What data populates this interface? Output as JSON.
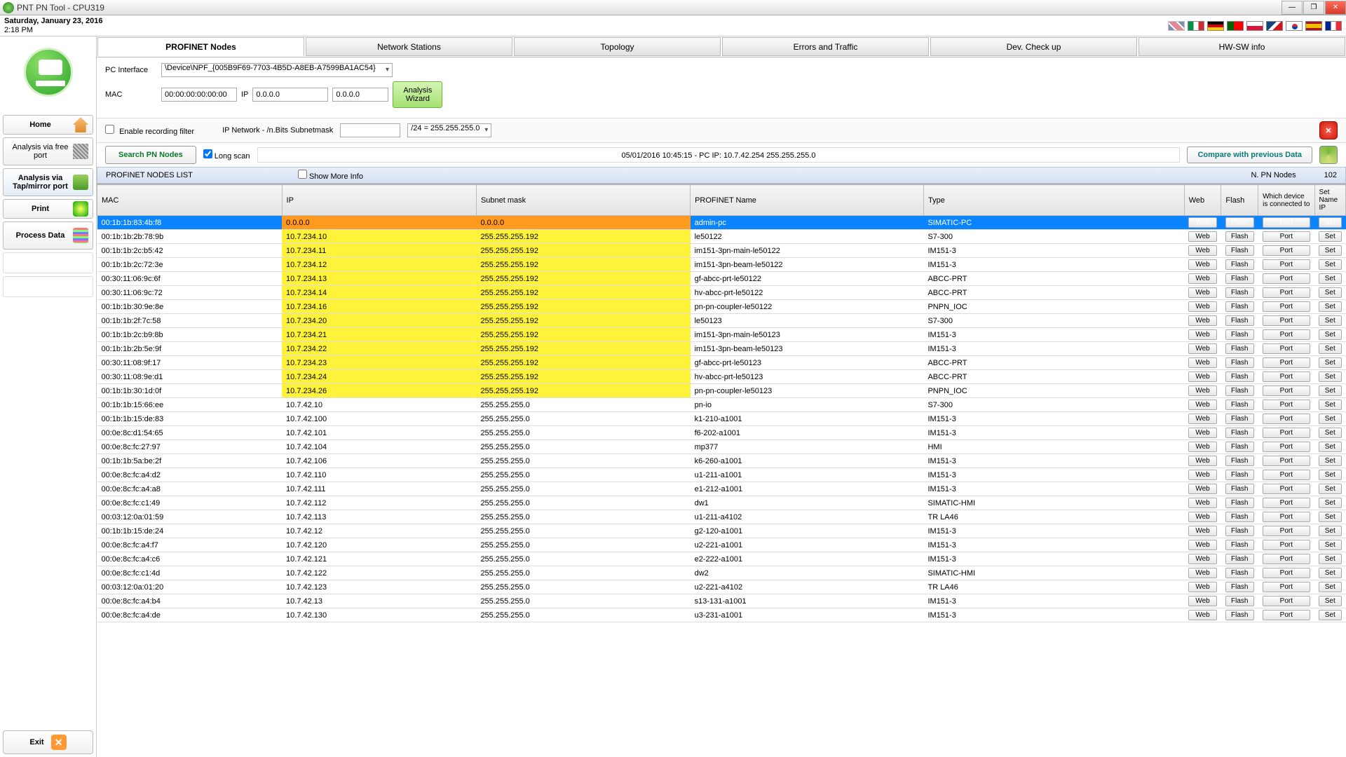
{
  "window": {
    "title": "PNT PN Tool - CPU319",
    "date": "Saturday, January 23, 2016",
    "time": "2:18 PM"
  },
  "sidebar": {
    "home": "Home",
    "analysis_free": "Analysis via free port",
    "analysis_tap": "Analysis via Tap/mirror port",
    "print": "Print",
    "process_data": "Process Data",
    "exit": "Exit"
  },
  "tabs": [
    "PROFINET Nodes",
    "Network Stations",
    "Topology",
    "Errors and Traffic",
    "Dev. Check up",
    "HW-SW info"
  ],
  "toolbar": {
    "pc_interface_label": "PC Interface",
    "pc_interface_value": "\\Device\\NPF_{005B9F69-7703-4B5D-A8EB-A7599BA1AC54}",
    "mac_label": "MAC",
    "mac_value": "00:00:00:00:00:00",
    "ip_label": "IP",
    "ip_value": "0.0.0.0",
    "ip_value2": "0.0.0.0",
    "wizard": "Analysis Wizard",
    "enable_filter": "Enable recording filter",
    "ipnet_label": "IP Network - /n.Bits Subnetmask",
    "mask_select": "/24 = 255.255.255.0",
    "search": "Search PN Nodes",
    "long_scan": "Long scan",
    "scan_info": "05/01/2016   10:45:15 - PC IP: 10.7.42.254  255.255.255.0",
    "compare": "Compare with previous Data",
    "list_title": "PROFINET NODES LIST",
    "show_more": "Show More Info",
    "n_nodes_label": "N. PN Nodes",
    "n_nodes": "102"
  },
  "columns": {
    "mac": "MAC",
    "ip": "IP",
    "mask": "Subnet mask",
    "name": "PROFINET Name",
    "type": "Type",
    "web": "Web",
    "flash": "Flash",
    "port": "Which device is connected to",
    "set": "Set Name IP"
  },
  "btns": {
    "web": "Web",
    "flash": "Flash",
    "port": "Port",
    "set": "Set"
  },
  "rows": [
    {
      "mac": "00:1b:1b:83:4b:f8",
      "ip": "0.0.0.0",
      "mask": "0.0.0.0",
      "name": "admin-pc",
      "type": "SIMATIC-PC",
      "sel": true,
      "y": false
    },
    {
      "mac": "00:1b:1b:2b:78:9b",
      "ip": "10.7.234.10",
      "mask": "255.255.255.192",
      "name": "le50122",
      "type": "S7-300",
      "y": true
    },
    {
      "mac": "00:1b:1b:2c:b5:42",
      "ip": "10.7.234.11",
      "mask": "255.255.255.192",
      "name": "im151-3pn-main-le50122",
      "type": "IM151-3",
      "y": true
    },
    {
      "mac": "00:1b:1b:2c:72:3e",
      "ip": "10.7.234.12",
      "mask": "255.255.255.192",
      "name": "im151-3pn-beam-le50122",
      "type": "IM151-3",
      "y": true
    },
    {
      "mac": "00:30:11:06:9c:6f",
      "ip": "10.7.234.13",
      "mask": "255.255.255.192",
      "name": "gf-abcc-prt-le50122",
      "type": "ABCC-PRT",
      "y": true
    },
    {
      "mac": "00:30:11:06:9c:72",
      "ip": "10.7.234.14",
      "mask": "255.255.255.192",
      "name": "hv-abcc-prt-le50122",
      "type": "ABCC-PRT",
      "y": true
    },
    {
      "mac": "00:1b:1b:30:9e:8e",
      "ip": "10.7.234.16",
      "mask": "255.255.255.192",
      "name": "pn-pn-coupler-le50122",
      "type": "PNPN_IOC",
      "y": true
    },
    {
      "mac": "00:1b:1b:2f:7c:58",
      "ip": "10.7.234.20",
      "mask": "255.255.255.192",
      "name": "le50123",
      "type": "S7-300",
      "y": true
    },
    {
      "mac": "00:1b:1b:2c:b9:8b",
      "ip": "10.7.234.21",
      "mask": "255.255.255.192",
      "name": "im151-3pn-main-le50123",
      "type": "IM151-3",
      "y": true
    },
    {
      "mac": "00:1b:1b:2b:5e:9f",
      "ip": "10.7.234.22",
      "mask": "255.255.255.192",
      "name": "im151-3pn-beam-le50123",
      "type": "IM151-3",
      "y": true
    },
    {
      "mac": "00:30:11:08:9f:17",
      "ip": "10.7.234.23",
      "mask": "255.255.255.192",
      "name": "gf-abcc-prt-le50123",
      "type": "ABCC-PRT",
      "y": true
    },
    {
      "mac": "00:30:11:08:9e:d1",
      "ip": "10.7.234.24",
      "mask": "255.255.255.192",
      "name": "hv-abcc-prt-le50123",
      "type": "ABCC-PRT",
      "y": true
    },
    {
      "mac": "00:1b:1b:30:1d:0f",
      "ip": "10.7.234.26",
      "mask": "255.255.255.192",
      "name": "pn-pn-coupler-le50123",
      "type": "PNPN_IOC",
      "y": true
    },
    {
      "mac": "00:1b:1b:15:66:ee",
      "ip": "10.7.42.10",
      "mask": "255.255.255.0",
      "name": "pn-io",
      "type": "S7-300"
    },
    {
      "mac": "00:1b:1b:15:de:83",
      "ip": "10.7.42.100",
      "mask": "255.255.255.0",
      "name": "k1-210-a1001",
      "type": "IM151-3"
    },
    {
      "mac": "00:0e:8c:d1:54:65",
      "ip": "10.7.42.101",
      "mask": "255.255.255.0",
      "name": "f6-202-a1001",
      "type": "IM151-3"
    },
    {
      "mac": "00:0e:8c:fc:27:97",
      "ip": "10.7.42.104",
      "mask": "255.255.255.0",
      "name": "mp377",
      "type": "HMI"
    },
    {
      "mac": "00:1b:1b:5a:be:2f",
      "ip": "10.7.42.106",
      "mask": "255.255.255.0",
      "name": "k6-260-a1001",
      "type": "IM151-3"
    },
    {
      "mac": "00:0e:8c:fc:a4:d2",
      "ip": "10.7.42.110",
      "mask": "255.255.255.0",
      "name": "u1-211-a1001",
      "type": "IM151-3"
    },
    {
      "mac": "00:0e:8c:fc:a4:a8",
      "ip": "10.7.42.111",
      "mask": "255.255.255.0",
      "name": "e1-212-a1001",
      "type": "IM151-3"
    },
    {
      "mac": "00:0e:8c:fc:c1:49",
      "ip": "10.7.42.112",
      "mask": "255.255.255.0",
      "name": "dw1",
      "type": "SIMATIC-HMI"
    },
    {
      "mac": "00:03:12:0a:01:59",
      "ip": "10.7.42.113",
      "mask": "255.255.255.0",
      "name": "u1-211-a4102",
      "type": "TR LA46"
    },
    {
      "mac": "00:1b:1b:15:de:24",
      "ip": "10.7.42.12",
      "mask": "255.255.255.0",
      "name": "g2-120-a1001",
      "type": "IM151-3"
    },
    {
      "mac": "00:0e:8c:fc:a4:f7",
      "ip": "10.7.42.120",
      "mask": "255.255.255.0",
      "name": "u2-221-a1001",
      "type": "IM151-3"
    },
    {
      "mac": "00:0e:8c:fc:a4:c6",
      "ip": "10.7.42.121",
      "mask": "255.255.255.0",
      "name": "e2-222-a1001",
      "type": "IM151-3"
    },
    {
      "mac": "00:0e:8c:fc:c1:4d",
      "ip": "10.7.42.122",
      "mask": "255.255.255.0",
      "name": "dw2",
      "type": "SIMATIC-HMI"
    },
    {
      "mac": "00:03:12:0a:01:20",
      "ip": "10.7.42.123",
      "mask": "255.255.255.0",
      "name": "u2-221-a4102",
      "type": "TR LA46"
    },
    {
      "mac": "00:0e:8c:fc:a4:b4",
      "ip": "10.7.42.13",
      "mask": "255.255.255.0",
      "name": "s13-131-a1001",
      "type": "IM151-3"
    },
    {
      "mac": "00:0e:8c:fc:a4:de",
      "ip": "10.7.42.130",
      "mask": "255.255.255.0",
      "name": "u3-231-a1001",
      "type": "IM151-3"
    }
  ]
}
